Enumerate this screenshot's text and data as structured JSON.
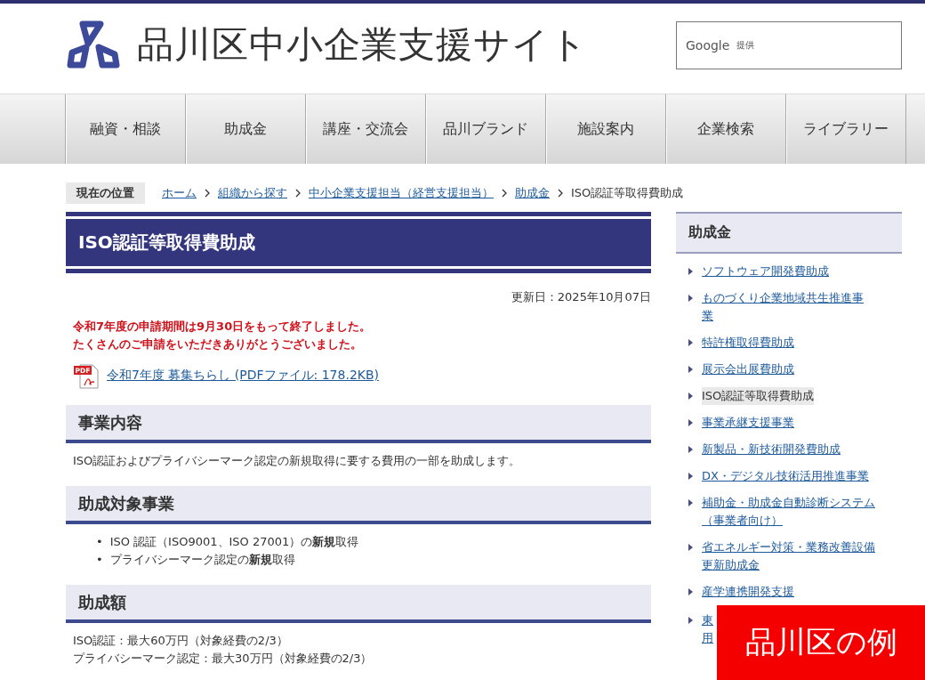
{
  "header": {
    "site_title": "品川区中小企業支援サイト",
    "search": {
      "provider": "Google",
      "provider_note": "提供"
    }
  },
  "nav": [
    {
      "label": "融資・相談"
    },
    {
      "label": "助成金"
    },
    {
      "label": "講座・交流会"
    },
    {
      "label": "品川ブランド"
    },
    {
      "label": "施設案内"
    },
    {
      "label": "企業検索"
    },
    {
      "label": "ライブラリー"
    }
  ],
  "breadcrumb": {
    "label": "現在の位置",
    "items": [
      {
        "text": "ホーム",
        "kind": "link"
      },
      {
        "text": "組織から探す",
        "kind": "link"
      },
      {
        "text": "中小企業支援担当（経営支援担当）",
        "kind": "link"
      },
      {
        "text": "助成金",
        "kind": "link"
      },
      {
        "text": "ISO認証等取得費助成",
        "kind": "current"
      }
    ]
  },
  "page": {
    "title": "ISO認証等取得費助成",
    "updated": "更新日：2025年10月07日",
    "notice": [
      "令和7年度の申請期間は9月30日をもって終了しました。",
      "たくさんのご申請をいただきありがとうございました。"
    ],
    "attachment": {
      "icon_label": "PDF",
      "text": "令和7年度 募集ちらし (PDFファイル: 178.2KB)"
    },
    "sections": [
      {
        "heading": "事業内容",
        "kind": "paragraph",
        "lines": [
          "ISO認証およびプライバシーマーク認定の新規取得に要する費用の一部を助成します。"
        ]
      },
      {
        "heading": "助成対象事業",
        "kind": "bullets",
        "lines": [
          {
            "marker": "•",
            "text": "ISO 認証（ISO9001、ISO 27001）の**新規**取得"
          },
          {
            "marker": "•",
            "text": "プライバシーマーク認定の**新規**取得"
          }
        ]
      },
      {
        "heading": "助成額",
        "kind": "paragraph",
        "lines": [
          "ISO認証：最大60万円（対象経費の2/3）",
          "プライバシーマーク認定：最大30万円（対象経費の2/3）"
        ]
      }
    ]
  },
  "sidebar": {
    "heading": "助成金",
    "items": [
      {
        "lines": [
          "ソフトウェア開発費助成"
        ],
        "selected": false
      },
      {
        "lines": [
          "ものづくり企業地域共生推進事",
          "業"
        ],
        "selected": false
      },
      {
        "lines": [
          "特許権取得費助成"
        ],
        "selected": false
      },
      {
        "lines": [
          "展示会出展費助成"
        ],
        "selected": false
      },
      {
        "lines": [
          "ISO認証等取得費助成"
        ],
        "selected": true
      },
      {
        "lines": [
          "事業承継支援事業"
        ],
        "selected": false
      },
      {
        "lines": [
          "新製品・新技術開発費助成"
        ],
        "selected": false
      },
      {
        "lines": [
          "DX・デジタル技術活用推進事業"
        ],
        "selected": false
      },
      {
        "lines": [
          "補助金・助成金自動診断システム",
          "（事業者向け）"
        ],
        "selected": false
      },
      {
        "lines": [
          "省エネルギー対策・業務改善設備",
          "更新助成金"
        ],
        "selected": false
      },
      {
        "lines": [
          "産学連携開発支援"
        ],
        "selected": false
      },
      {
        "lines": [
          "東",
          "用"
        ],
        "selected": false
      }
    ]
  },
  "overlay_label": "品川区の例"
}
